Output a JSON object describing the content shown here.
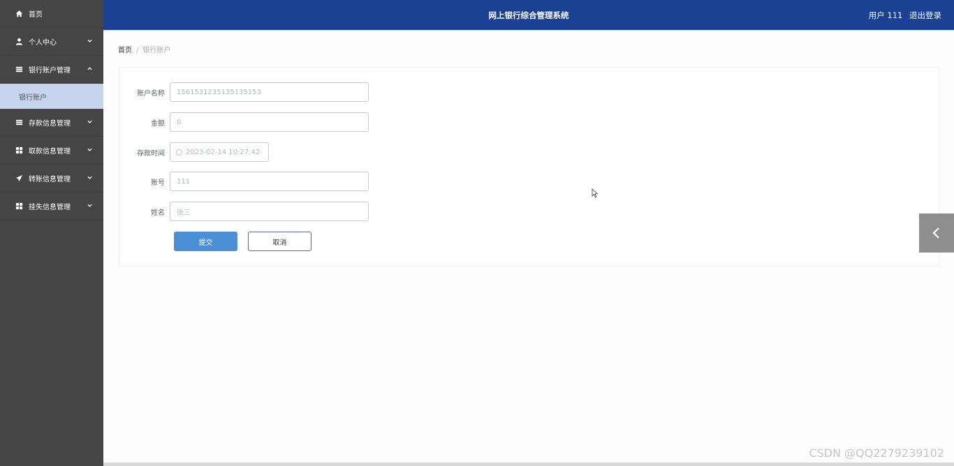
{
  "sidebar": {
    "items": [
      {
        "label": "首页",
        "icon": "home-icon"
      },
      {
        "label": "个人中心",
        "icon": "user-icon"
      },
      {
        "label": "银行账户管理",
        "icon": "list-icon"
      },
      {
        "label": "存款信息管理",
        "icon": "list-icon"
      },
      {
        "label": "取款信息管理",
        "icon": "grid-icon"
      },
      {
        "label": "转账信息管理",
        "icon": "send-icon"
      },
      {
        "label": "挂失信息管理",
        "icon": "grid-icon"
      }
    ],
    "sub_item": "银行账户"
  },
  "header": {
    "title": "网上银行综合管理系统",
    "user_label": "用户 111",
    "logout_label": "退出登录"
  },
  "breadcrumb": {
    "home": "首页",
    "separator": "/",
    "current": "银行账户"
  },
  "form": {
    "account_name": {
      "label": "账户名称",
      "value": "1561531235135135153"
    },
    "amount": {
      "label": "金额",
      "value": "0"
    },
    "deposit_time": {
      "label": "存款时间",
      "value": "2023-02-14 10:27:42"
    },
    "account_no": {
      "label": "账号",
      "value": "111"
    },
    "name": {
      "label": "姓名",
      "value": "张三"
    },
    "submit_label": "提交",
    "cancel_label": "取消"
  },
  "watermark": "CSDN @QQ2279239102",
  "colors": {
    "header": "#1b4193",
    "sidebar": "#454545",
    "sidebar_active": "#c6d4ee",
    "primary_button": "#4b8fd6"
  }
}
